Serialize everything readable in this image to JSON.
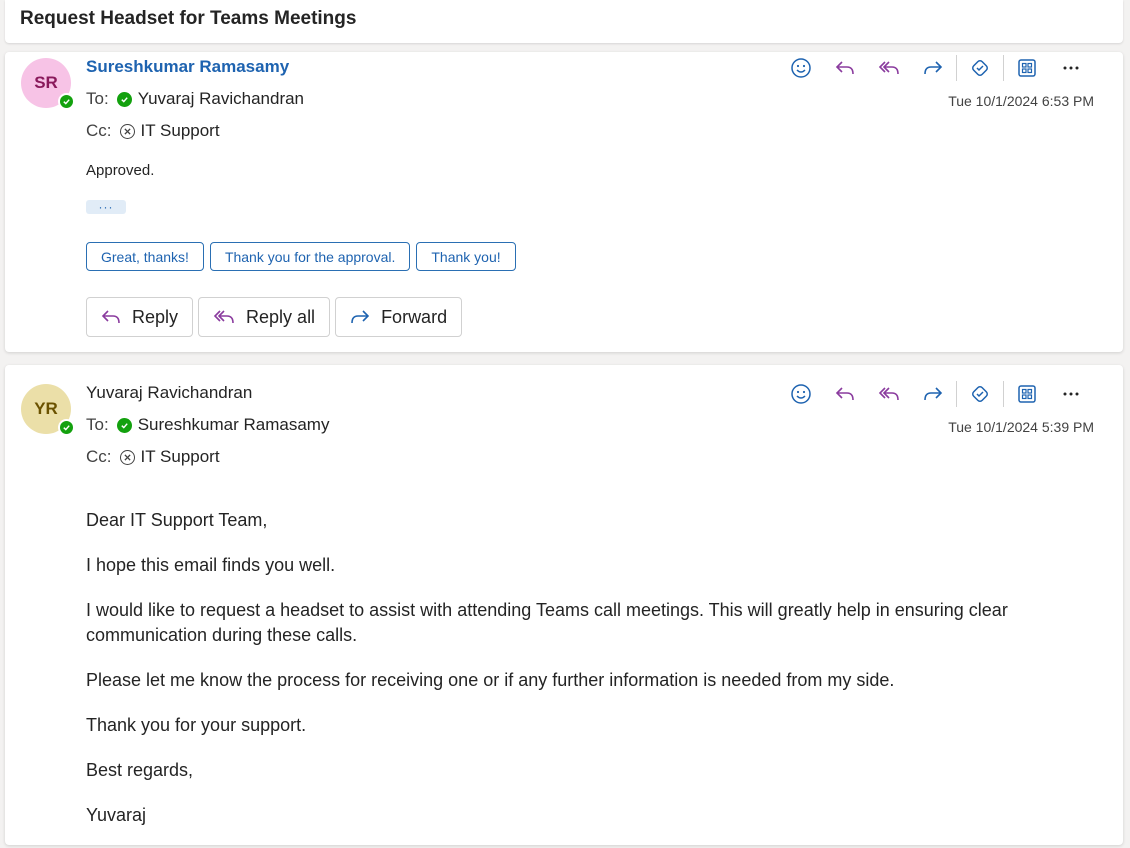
{
  "subject": "Request Headset for Teams Meetings",
  "messages": [
    {
      "initials": "SR",
      "sender": "Sureshkumar Ramasamy",
      "to_label": "To:",
      "to": "Yuvaraj Ravichandran",
      "cc_label": "Cc:",
      "cc": "IT Support",
      "timestamp": "Tue 10/1/2024 6:53 PM",
      "body": "Approved.",
      "collapsed_indicator": "···",
      "suggested_replies": [
        "Great, thanks!",
        "Thank you for the approval.",
        "Thank you!"
      ],
      "actions": {
        "reply": "Reply",
        "reply_all": "Reply all",
        "forward": "Forward"
      }
    },
    {
      "initials": "YR",
      "sender": "Yuvaraj Ravichandran",
      "to_label": "To:",
      "to": "Sureshkumar Ramasamy",
      "cc_label": "Cc:",
      "cc": "IT Support",
      "timestamp": "Tue 10/1/2024 5:39 PM",
      "body_paragraphs": [
        "Dear IT Support Team,",
        "I hope this email finds you well.",
        "I would like to request a headset to assist with attending Teams call meetings. This will greatly help in ensuring clear communication during these calls.",
        "Please let me know the process for receiving one or if any further information is needed from my side.",
        "Thank you for your support.",
        "Best regards,",
        "Yuvaraj"
      ]
    }
  ],
  "colors": {
    "accent": "#1e63b0",
    "reply_purple": "#8a3b9e",
    "presence_green": "#13a10e",
    "avatar_sr": "#f7c3e6",
    "avatar_yr": "#ebdfa8"
  },
  "icons": [
    "emoji-icon",
    "reply-icon",
    "reply-all-icon",
    "forward-icon",
    "loop-icon",
    "apps-icon",
    "more-icon"
  ]
}
